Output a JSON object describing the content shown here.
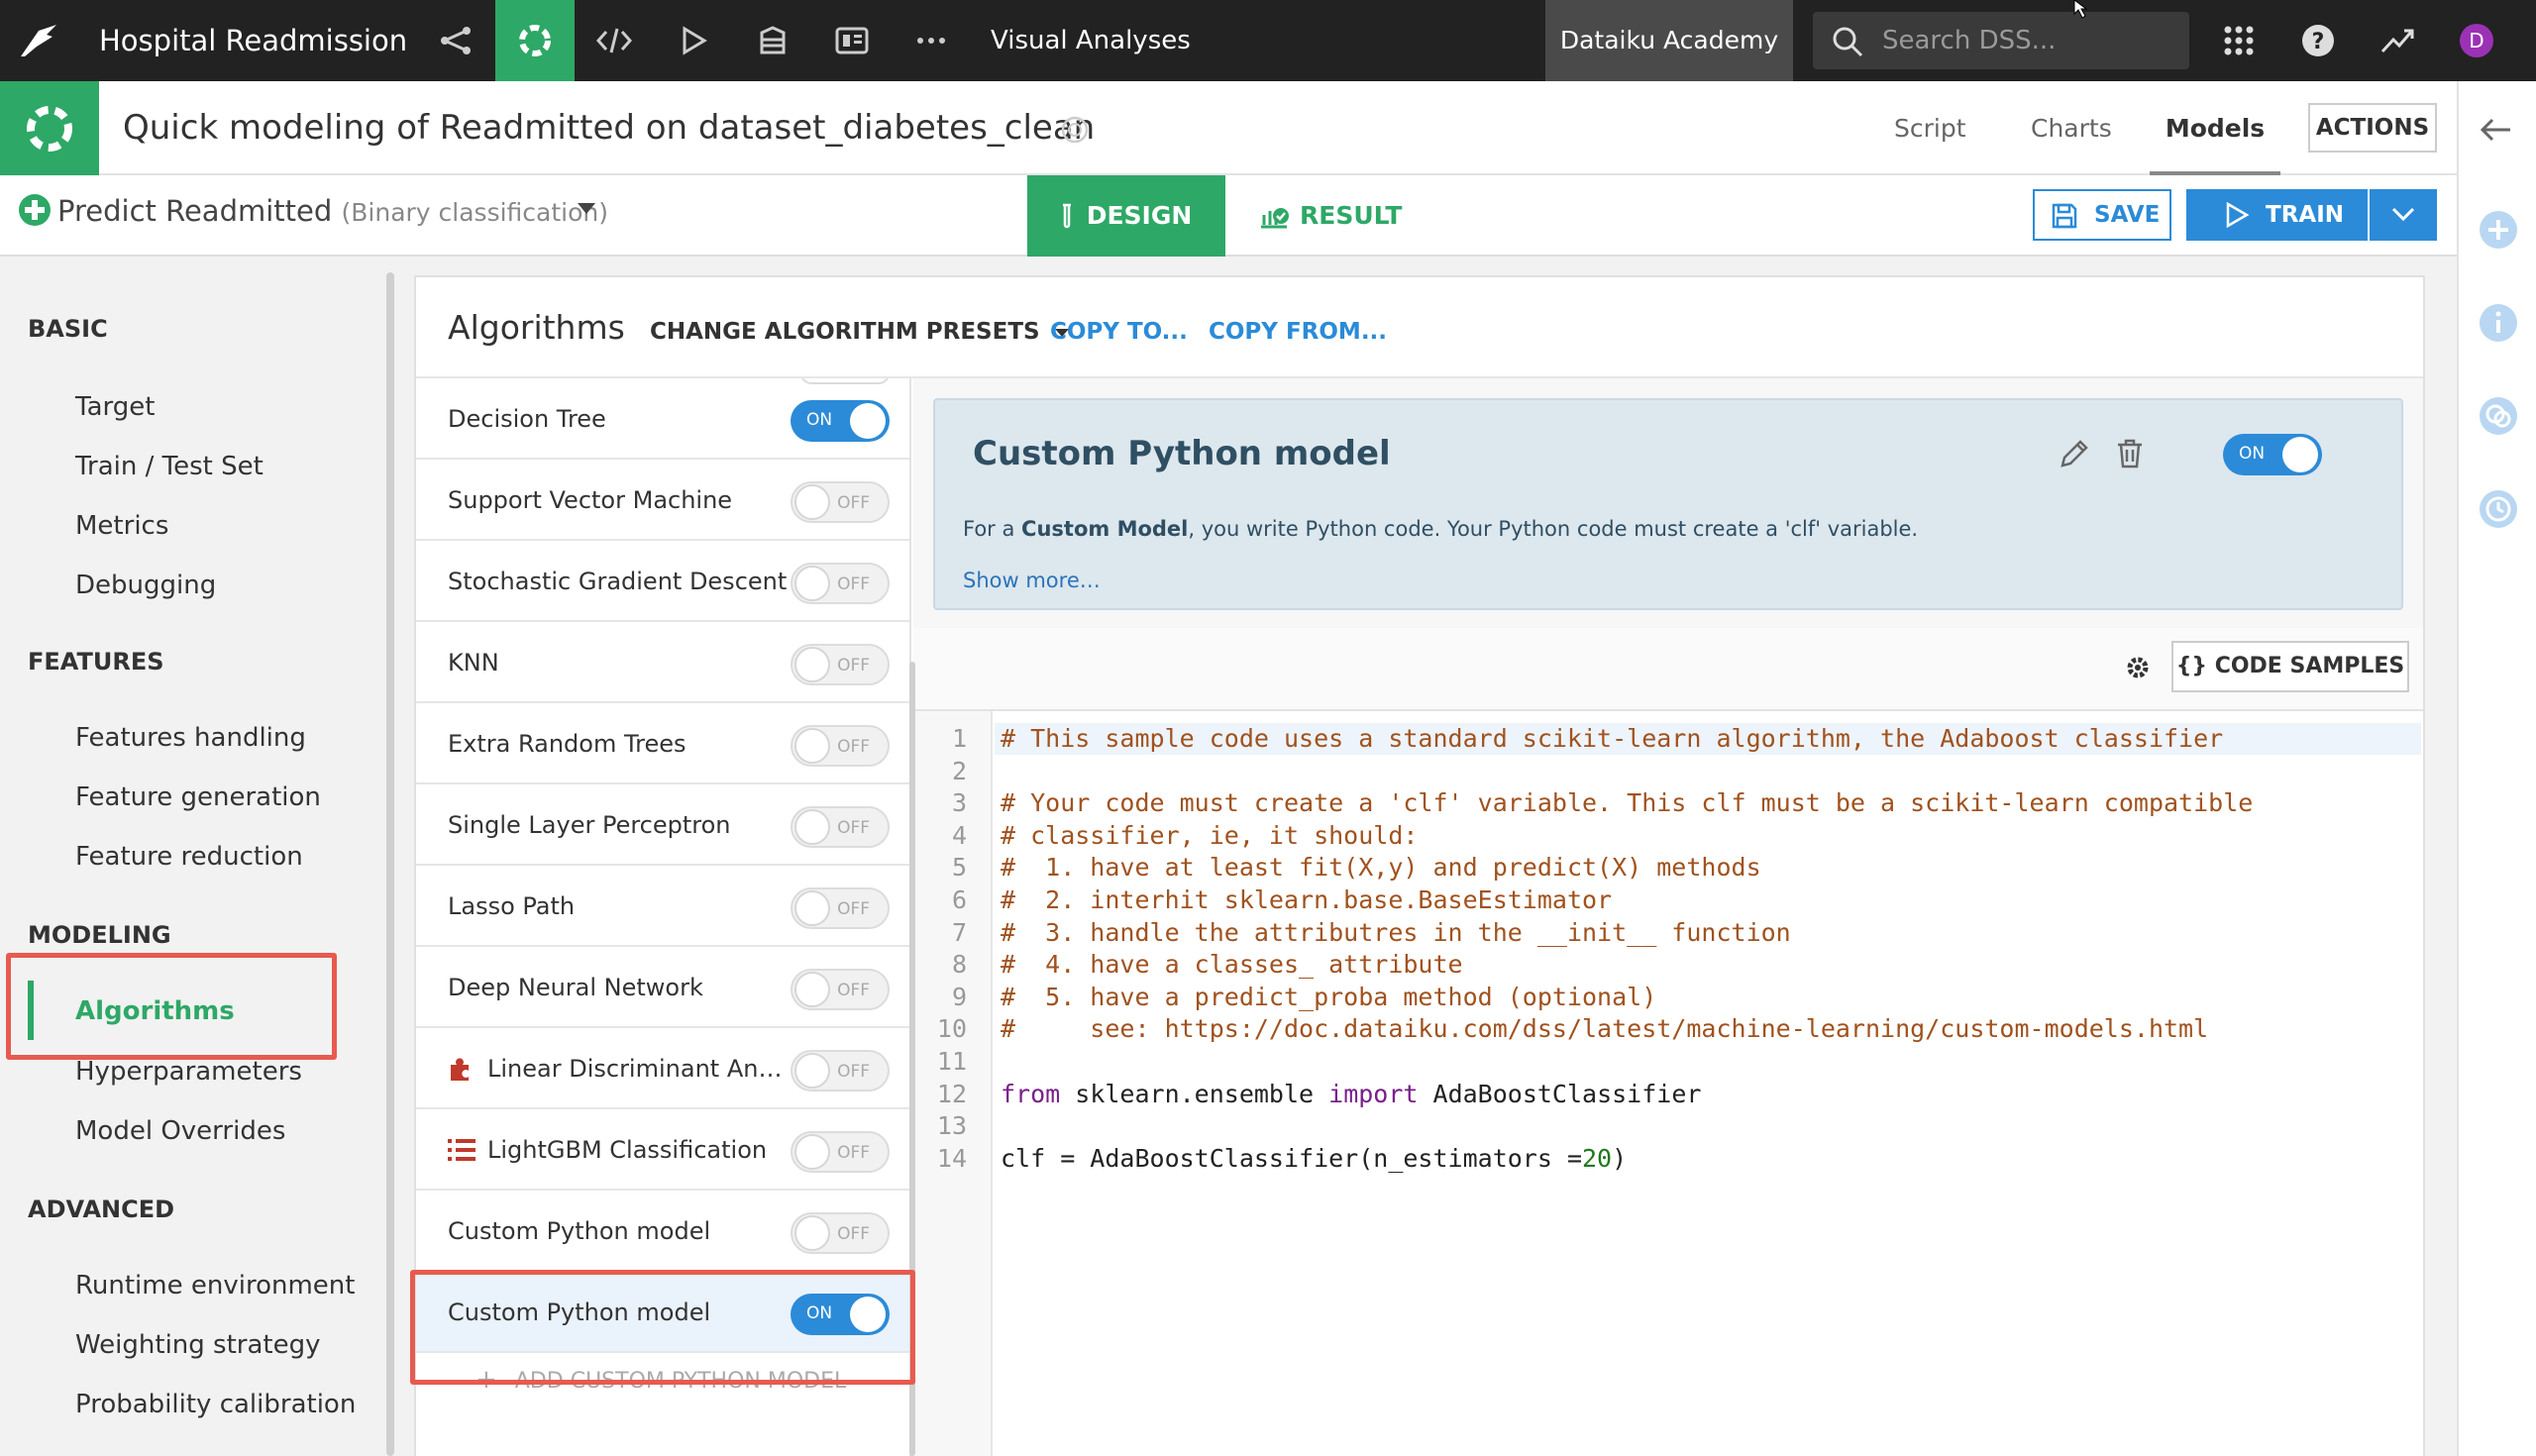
{
  "nav": {
    "app_name": "Hospital Readmission",
    "section_title": "Visual Analyses",
    "academy_label": "Dataiku Academy",
    "search_placeholder": "Search DSS...",
    "avatar_letter": "D"
  },
  "header": {
    "title": "Quick modeling of Readmitted on dataset_diabetes_clean",
    "tabs": [
      "Script",
      "Charts",
      "Models"
    ],
    "active_tab": "Models",
    "actions_label": "ACTIONS"
  },
  "subheader": {
    "task_name": "Predict Readmitted",
    "task_type": "(Binary classification)",
    "design_label": "DESIGN",
    "result_label": "RESULT",
    "save_label": "SAVE",
    "train_label": "TRAIN"
  },
  "sidebar": {
    "sections": [
      {
        "title": "BASIC",
        "items": [
          "Target",
          "Train / Test Set",
          "Metrics",
          "Debugging"
        ]
      },
      {
        "title": "FEATURES",
        "items": [
          "Features handling",
          "Feature generation",
          "Feature reduction"
        ]
      },
      {
        "title": "MODELING",
        "items": [
          "Algorithms",
          "Hyperparameters",
          "Model Overrides"
        ]
      },
      {
        "title": "ADVANCED",
        "items": [
          "Runtime environment",
          "Weighting strategy",
          "Probability calibration"
        ]
      }
    ],
    "active_item": "Algorithms"
  },
  "main": {
    "title": "Algorithms",
    "presets_label": "CHANGE ALGORITHM PRESETS",
    "copy_to_label": "COPY TO...",
    "copy_from_label": "COPY FROM...",
    "on_label": "ON",
    "off_label": "OFF",
    "algorithms": [
      {
        "name": "Decision Tree",
        "enabled": true
      },
      {
        "name": "Support Vector Machine",
        "enabled": false
      },
      {
        "name": "Stochastic Gradient Descent",
        "enabled": false
      },
      {
        "name": "KNN",
        "enabled": false
      },
      {
        "name": "Extra Random Trees",
        "enabled": false
      },
      {
        "name": "Single Layer Perceptron",
        "enabled": false
      },
      {
        "name": "Lasso Path",
        "enabled": false
      },
      {
        "name": "Deep Neural Network",
        "enabled": false
      },
      {
        "name": "Linear Discriminant An…",
        "enabled": false,
        "icon": "plugin-icon"
      },
      {
        "name": "LightGBM Classification",
        "enabled": false,
        "icon": "list-icon"
      },
      {
        "name": "Custom Python model",
        "enabled": false
      },
      {
        "name": "Custom Python model",
        "enabled": true,
        "selected": true
      }
    ],
    "add_custom_label": "ADD CUSTOM PYTHON MODEL"
  },
  "detail": {
    "title": "Custom Python model",
    "desc_prefix": "For a ",
    "desc_bold": "Custom Model",
    "desc_suffix": ", you write Python code. Your Python code must create a 'clf' variable.",
    "show_more": "Show more…",
    "code_samples_label": "{} CODE SAMPLES",
    "code_lines": [
      "# This sample code uses a standard scikit-learn algorithm, the Adaboost classifier",
      "",
      "# Your code must create a 'clf' variable. This clf must be a scikit-learn compatible",
      "# classifier, ie, it should:",
      "#  1. have at least fit(X,y) and predict(X) methods",
      "#  2. interhit sklearn.base.BaseEstimator",
      "#  3. handle the attributres in the __init__ function",
      "#  4. have a classes_ attribute",
      "#  5. have a predict_proba method (optional)",
      "#     see: https://doc.dataiku.com/dss/latest/machine-learning/custom-models.html",
      "",
      "from sklearn.ensemble import AdaBoostClassifier",
      "",
      "clf = AdaBoostClassifier(n_estimators =20)"
    ]
  },
  "colors": {
    "nav_bg": "#222222",
    "accent_green": "#2ea866",
    "accent_blue": "#2b8bd8",
    "highlight_red": "#e85a4f"
  }
}
